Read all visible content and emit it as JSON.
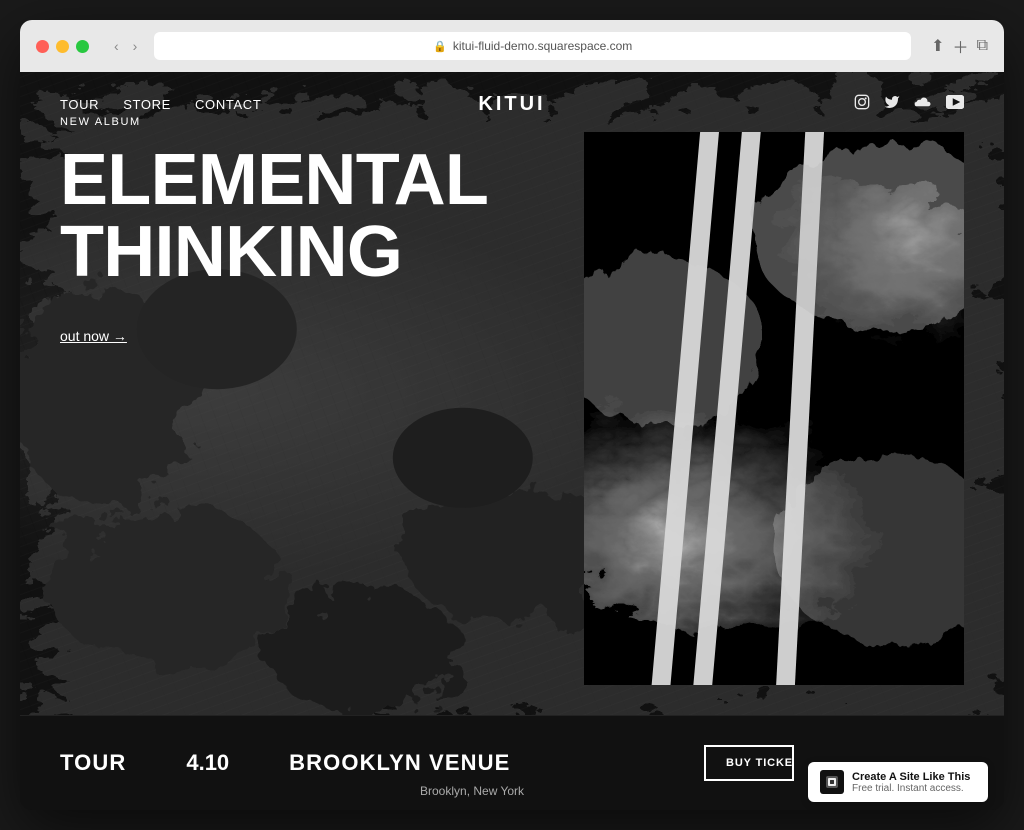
{
  "browser": {
    "url": "kitui-fluid-demo.squarespace.com",
    "back_btn": "‹",
    "forward_btn": "›"
  },
  "nav": {
    "links": [
      "TOUR",
      "STORE",
      "CONTACT"
    ],
    "logo": "KITUI",
    "social_icons": [
      "instagram",
      "twitter",
      "soundcloud",
      "youtube"
    ]
  },
  "hero": {
    "new_album_label": "NEW ALBUM",
    "album_title_line1": "ELEMENTAL",
    "album_title_line2": "THINKING",
    "out_now_link": "out now →"
  },
  "tour": {
    "label": "TOUR",
    "date": "4.10",
    "venue": "BROOKLYN VENUE",
    "location": "Brooklyn, New York",
    "buy_tickets_label": "BUY TICKETS"
  },
  "squarespace": {
    "logo_char": "◈",
    "title": "Create A Site Like This",
    "subtitle": "Free trial. Instant access."
  }
}
